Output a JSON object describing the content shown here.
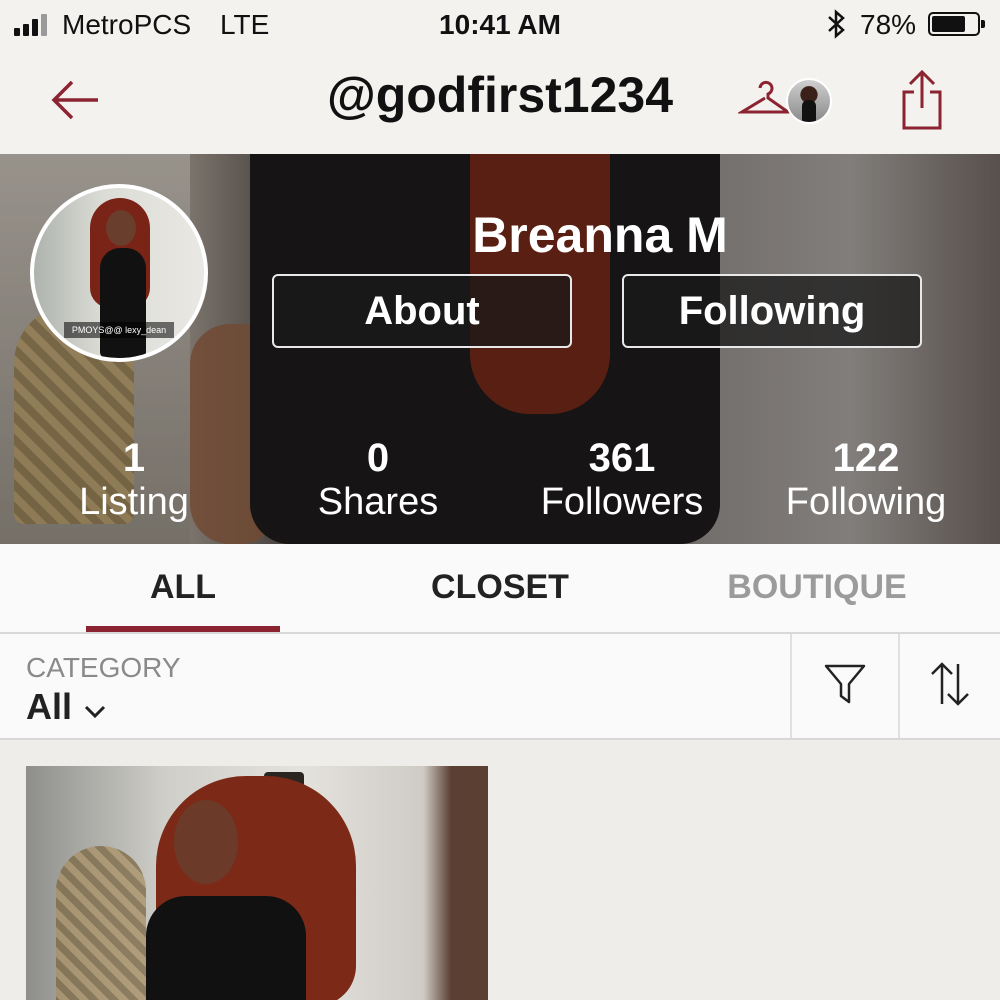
{
  "status_bar": {
    "carrier": "MetroPCS",
    "network": "LTE",
    "time": "10:41 AM",
    "battery_percent": "78%",
    "battery_level": 0.78
  },
  "nav": {
    "title": "@godfirst1234"
  },
  "profile": {
    "name": "Breanna M",
    "photo_tag": "PMOYS@@ lexy_dean",
    "about_label": "About",
    "following_button_label": "Following",
    "stats": [
      {
        "value": "1",
        "label": "Listing"
      },
      {
        "value": "0",
        "label": "Shares"
      },
      {
        "value": "361",
        "label": "Followers"
      },
      {
        "value": "122",
        "label": "Following"
      }
    ]
  },
  "tabs": [
    {
      "label": "ALL",
      "active": true
    },
    {
      "label": "CLOSET",
      "active": false
    },
    {
      "label": "BOUTIQUE",
      "active": false
    }
  ],
  "filter": {
    "category_label": "CATEGORY",
    "category_value": "All"
  },
  "colors": {
    "accent": "#8b2331",
    "inactive_tab": "#9b9b9b"
  },
  "icons": [
    "back-arrow-icon",
    "hanger-icon",
    "share-icon",
    "bluetooth-icon",
    "chevron-down-icon",
    "filter-icon",
    "sort-icon"
  ]
}
